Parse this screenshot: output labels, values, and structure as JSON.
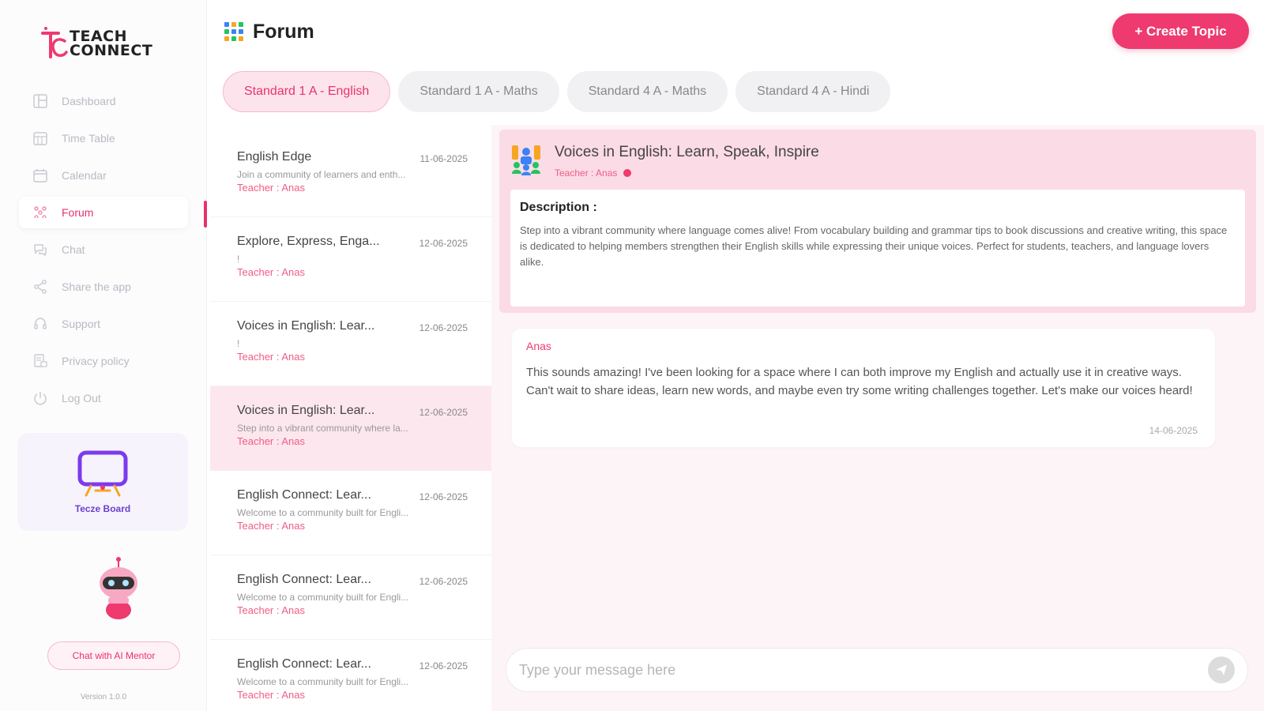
{
  "brand": {
    "logo_line1": "TEACH",
    "logo_line2": "CONNECT",
    "accent_color": "#ee3a6e"
  },
  "sidebar": {
    "items": [
      {
        "label": "Dashboard",
        "icon": "dashboard-icon"
      },
      {
        "label": "Time Table",
        "icon": "timetable-icon"
      },
      {
        "label": "Calendar",
        "icon": "calendar-icon"
      },
      {
        "label": "Forum",
        "icon": "forum-icon",
        "active": true
      },
      {
        "label": "Chat",
        "icon": "chat-icon"
      },
      {
        "label": "Share the app",
        "icon": "share-icon"
      },
      {
        "label": "Support",
        "icon": "support-icon"
      },
      {
        "label": "Privacy policy",
        "icon": "privacy-icon"
      },
      {
        "label": "Log Out",
        "icon": "logout-icon"
      }
    ],
    "board_label": "Tecze Board",
    "mentor_button": "Chat with AI Mentor",
    "version": "Version 1.0.0"
  },
  "header": {
    "title": "Forum",
    "create_button": "+ Create Topic"
  },
  "tabs": [
    {
      "label": "Standard 1 A - English",
      "active": true
    },
    {
      "label": "Standard 1 A - Maths"
    },
    {
      "label": "Standard 4 A - Maths"
    },
    {
      "label": "Standard 4 A - Hindi"
    }
  ],
  "topics": [
    {
      "title": "English Edge",
      "date": "11-06-2025",
      "desc": "Join a community of learners and enth...",
      "teacher": "Teacher : Anas"
    },
    {
      "title": "Explore, Express, Enga...",
      "date": "12-06-2025",
      "desc": "!",
      "teacher": "Teacher : Anas"
    },
    {
      "title": "Voices in English: Lear...",
      "date": "12-06-2025",
      "desc": "!",
      "teacher": "Teacher : Anas"
    },
    {
      "title": "Voices in English: Lear...",
      "date": "12-06-2025",
      "desc": "Step into a vibrant community where la...",
      "teacher": "Teacher : Anas",
      "active": true
    },
    {
      "title": "English Connect: Lear...",
      "date": "12-06-2025",
      "desc": "Welcome to a community built for Engli...",
      "teacher": "Teacher : Anas"
    },
    {
      "title": "English Connect: Lear...",
      "date": "12-06-2025",
      "desc": "Welcome to a community built for Engli...",
      "teacher": "Teacher : Anas"
    },
    {
      "title": "English Connect: Lear...",
      "date": "12-06-2025",
      "desc": "Welcome to a community built for Engli...",
      "teacher": "Teacher : Anas"
    }
  ],
  "detail": {
    "title": "Voices in English: Learn, Speak, Inspire",
    "teacher": "Teacher : Anas",
    "description_label": "Description :",
    "description": "Step into a vibrant community where language comes alive! From vocabulary building and grammar tips to book discussions and creative writing, this space is dedicated to helping members strengthen their English skills while expressing their unique voices. Perfect for students, teachers, and language lovers alike."
  },
  "message": {
    "author": "Anas",
    "text": "This sounds amazing! I've been looking for a space where I can both improve my English and actually use it in creative ways. Can't wait to share ideas, learn new words, and maybe even try some writing challenges together. Let's make our voices heard!",
    "date": "14-06-2025"
  },
  "composer": {
    "placeholder": "Type your message here"
  }
}
